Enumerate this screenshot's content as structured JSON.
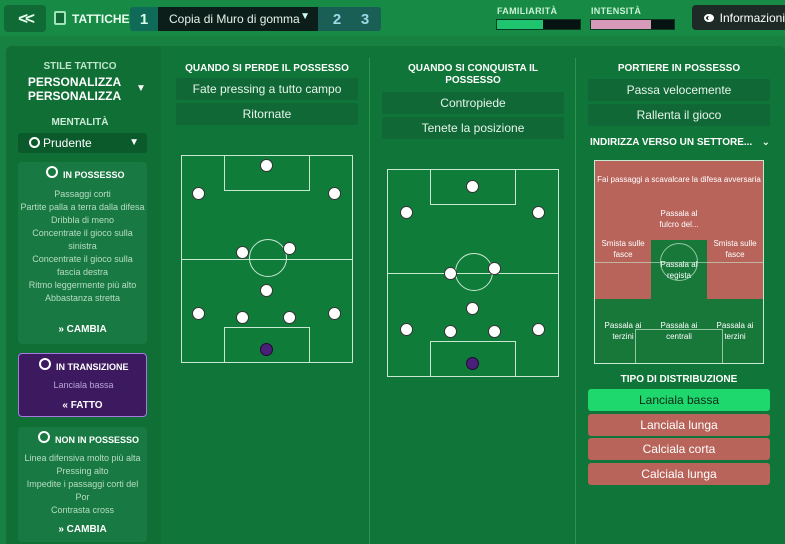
{
  "topbar": {
    "back_icon": "double-chevron-left-icon",
    "title": "TATTICHE",
    "tactics": [
      {
        "number": "1",
        "name": "Copia di Muro di gomma"
      },
      {
        "number": "2"
      },
      {
        "number": "3"
      }
    ],
    "familiarity": {
      "label": "FAMILIARITÀ",
      "fraction": 0.55,
      "color": "#1fc46e"
    },
    "intensity": {
      "label": "INTENSITÀ",
      "fraction": 0.72,
      "color": "#d79ab8"
    },
    "info_label": "Informazioni"
  },
  "left": {
    "style_title": "STILE TATTICO",
    "style_value_line1": "PERSONALIZZA",
    "style_value_line2": "PERSONALIZZA",
    "mentality_title": "MENTALITÀ",
    "mentality_value": "Prudente",
    "in_possession": {
      "title": "IN POSSESSO",
      "items": [
        "Passaggi corti",
        "Partite palla a terra dalla difesa",
        "Dribbla di meno",
        "Concentrate il gioco sulla sinistra",
        "Concentrate il gioco sulla fascia destra",
        "Ritmo leggermente più alto",
        "Abbastanza stretta"
      ],
      "button": "CAMBIA"
    },
    "transition": {
      "title": "IN TRANSIZIONE",
      "items": [
        "Lanciala bassa"
      ],
      "button": "FATTO"
    },
    "out_possession": {
      "title": "NON IN POSSESSO",
      "items": [
        "Linea difensiva molto più alta",
        "Pressing alto",
        "Impedite i passaggi corti del Por",
        "Contrasta cross"
      ],
      "button": "CAMBIA"
    }
  },
  "col1": {
    "title": "QUANDO SI PERDE IL POSSESSO",
    "options": [
      "Fate pressing a tutto campo",
      "Ritornate"
    ]
  },
  "col2": {
    "title_line1": "QUANDO SI CONQUISTA IL",
    "title_line2": "POSSESSO",
    "options": [
      "Contropiede",
      "Tenete la posizione"
    ]
  },
  "col3": {
    "title": "PORTIERE IN POSSESSO",
    "options": [
      "Passa velocemente",
      "Rallenta il gioco"
    ],
    "direct_title": "INDIRIZZA VERSO UN SETTORE...",
    "zones": {
      "top": "Fai passaggi a scavalcare la difesa avversaria",
      "left": "Smista sulle fasce",
      "center_top": "Passala al fulcro del...",
      "right": "Smista sulle fasce",
      "center_mid": "Passala al regista",
      "bottom_left": "Passala ai terzini",
      "bottom_center": "Passala ai centrali",
      "bottom_right": "Passala ai terzini"
    },
    "distribution_title": "TIPO DI DISTRIBUZIONE",
    "distribution_options": [
      {
        "label": "Lanciala bassa",
        "selected": true
      },
      {
        "label": "Lanciala lunga",
        "selected": false
      },
      {
        "label": "Calciala corta",
        "selected": false
      },
      {
        "label": "Calciala lunga",
        "selected": false
      }
    ]
  }
}
